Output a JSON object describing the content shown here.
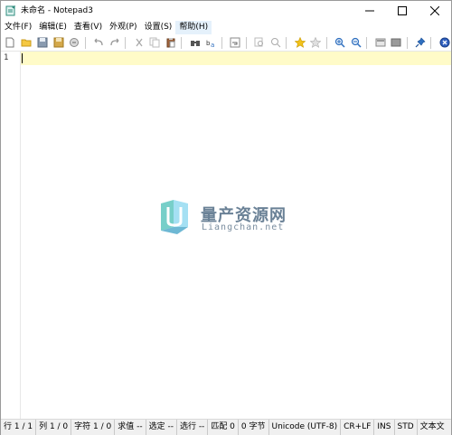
{
  "window": {
    "title": "未命名 - Notepad3"
  },
  "menu": {
    "items": [
      "文件(F)",
      "编辑(E)",
      "查看(V)",
      "外观(P)",
      "设置(S)",
      "帮助(H)"
    ],
    "active_index": 5
  },
  "toolbar": {
    "buttons": [
      "new-file-icon",
      "open-folder-icon",
      "save-icon",
      "save-as-icon",
      "browse-icon",
      "undo-icon",
      "redo-icon",
      "cut-icon",
      "copy-icon",
      "paste-icon",
      "find-icon",
      "replace-icon",
      "word-wrap-icon",
      "zoom-fit-icon",
      "favorites-icon",
      "add-favorite-icon",
      "zoom-in-icon",
      "zoom-out-icon",
      "schema-icon",
      "customize-icon",
      "pin-icon",
      "exit-icon"
    ]
  },
  "editor": {
    "line_numbers": [
      "1"
    ],
    "content": ""
  },
  "watermark": {
    "title": "量产资源网",
    "subtitle": "Liangchan.net"
  },
  "statusbar": {
    "line": "行 1 / 1",
    "column": "列 1 / 0",
    "chars": "字符 1 / 0",
    "value": "求值 --",
    "selected": "选定 --",
    "selected_lines": "选行 --",
    "matches": "匹配 0",
    "bytes": "0 字节",
    "encoding": "Unicode (UTF-8)",
    "eol": "CR+LF",
    "ins": "INS",
    "std": "STD",
    "doctype": "文本文"
  },
  "colors": {
    "current_line": "#fffbc8",
    "menu_active": "#e5f1fb",
    "statusbar_bg": "#f0f0f0"
  }
}
